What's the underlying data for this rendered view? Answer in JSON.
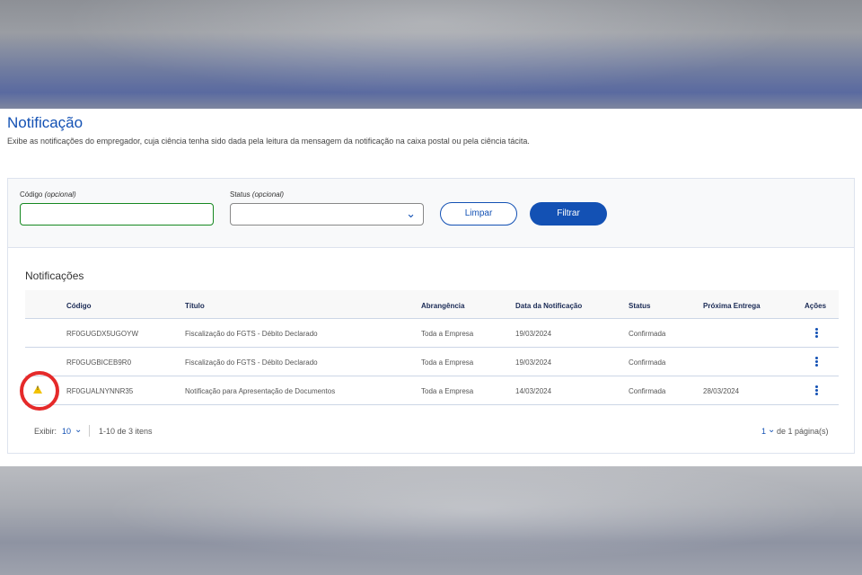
{
  "header": {
    "title": "Notificação",
    "description": "Exibe as notificações do empregador, cuja ciência tenha sido dada pela leitura da mensagem da notificação na caixa postal ou pela ciência tácita."
  },
  "filters": {
    "codigo_label": "Código",
    "codigo_hint": "(opcional)",
    "codigo_value": "",
    "status_label": "Status",
    "status_hint": "(opcional)",
    "status_value": "",
    "clear_label": "Limpar",
    "filter_label": "Filtrar"
  },
  "results": {
    "title": "Notificações",
    "columns": {
      "codigo": "Código",
      "titulo": "Título",
      "abrangencia": "Abrangência",
      "data": "Data da Notificação",
      "status": "Status",
      "proxima": "Próxima Entrega",
      "acoes": "Ações"
    },
    "rows": [
      {
        "codigo": "RF0GUGDX5UGOYW",
        "titulo": "Fiscalização do FGTS - Débito Declarado",
        "abrangencia": "Toda a Empresa",
        "data": "19/03/2024",
        "status": "Confirmada",
        "proxima": "",
        "warning": false
      },
      {
        "codigo": "RF0GUGBICEB9R0",
        "titulo": "Fiscalização do FGTS - Débito Declarado",
        "abrangencia": "Toda a Empresa",
        "data": "19/03/2024",
        "status": "Confirmada",
        "proxima": "",
        "warning": false
      },
      {
        "codigo": "RF0GUALNYNNR35",
        "titulo": "Notificação para Apresentação de Documentos",
        "abrangencia": "Toda a Empresa",
        "data": "14/03/2024",
        "status": "Confirmada",
        "proxima": "28/03/2024",
        "warning": true
      }
    ]
  },
  "pagination": {
    "show_label": "Exibir:",
    "page_size": "10",
    "items_info": "1-10 de 3 itens",
    "current_page": "1",
    "pages_info": "de 1 página(s)"
  },
  "icons": {
    "chevron": "chevron-down-icon",
    "kebab": "kebab-menu-icon",
    "warning": "warning-icon"
  },
  "colors": {
    "primary": "#1351b4",
    "success_border": "#168821",
    "warning": "#f2c200",
    "highlight_circle": "#e52a2a"
  }
}
